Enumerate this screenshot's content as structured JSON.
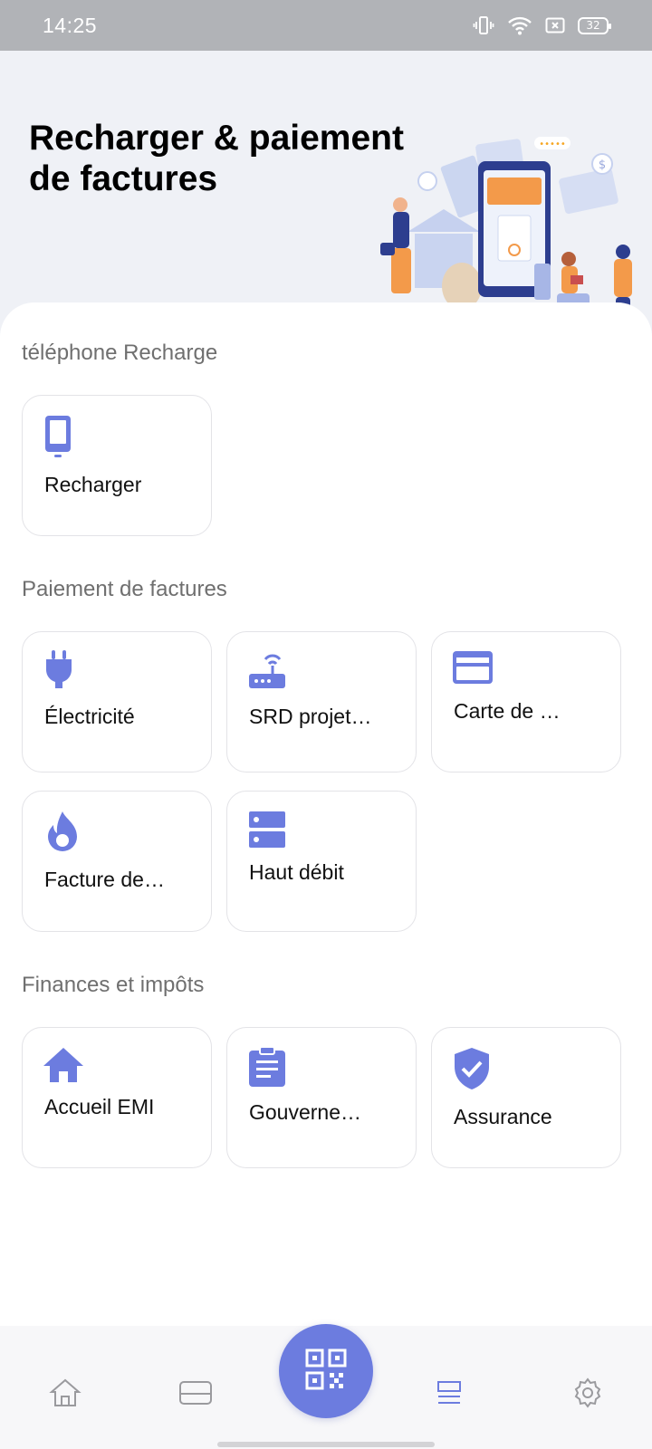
{
  "status_bar": {
    "time": "14:25",
    "battery": "32",
    "icons": [
      "vibrate-icon",
      "wifi-icon",
      "sim-icon",
      "battery-icon"
    ]
  },
  "header": {
    "title": "Recharger & paiement de factures",
    "illustration": "payment-illustration"
  },
  "sections": {
    "recharge": {
      "title": "téléphone Recharge",
      "items": [
        {
          "label": "Recharger",
          "icon": "phone-icon"
        }
      ]
    },
    "bills": {
      "title": "Paiement de factures",
      "items": [
        {
          "label": "Électricité",
          "icon": "plug-icon"
        },
        {
          "label": "SRD projet…",
          "icon": "router-icon"
        },
        {
          "label": "Carte de …",
          "icon": "credit-card-icon"
        },
        {
          "label": "Facture de…",
          "icon": "flame-icon"
        },
        {
          "label": "Haut débit",
          "icon": "server-icon"
        }
      ]
    },
    "finance": {
      "title": "Finances et impôts",
      "items": [
        {
          "label": "Accueil EMI",
          "icon": "home-icon"
        },
        {
          "label": "Gouverne…",
          "icon": "clipboard-icon"
        },
        {
          "label": "Assurance",
          "icon": "shield-check-icon"
        }
      ]
    }
  },
  "bottom_nav": {
    "items": [
      "home-icon",
      "card-icon",
      "scan-qr-icon",
      "list-icon",
      "settings-icon"
    ],
    "active": "list-icon"
  },
  "colors": {
    "accent": "#6c7cdf",
    "status_bar": "#b1b3b7",
    "header_bg": "#eff1f6"
  }
}
